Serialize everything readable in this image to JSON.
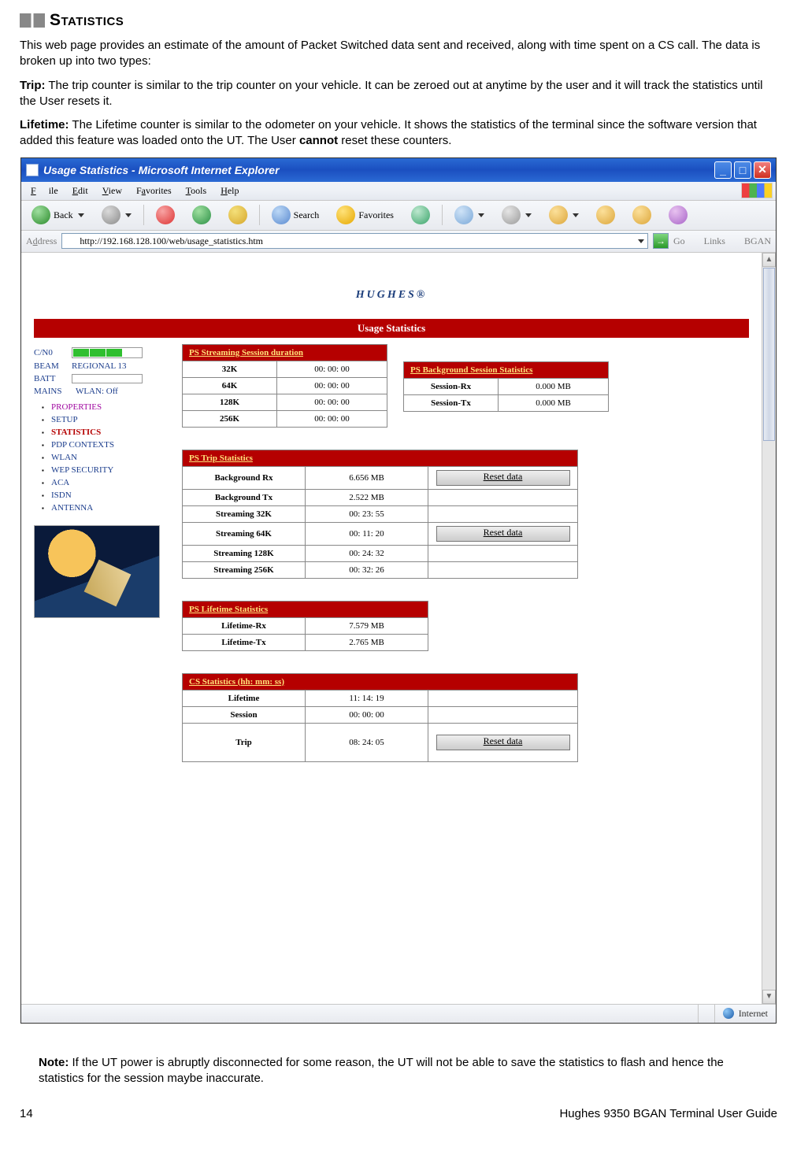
{
  "doc": {
    "section_title": "Statistics",
    "para1": "This web page provides an estimate of the amount of Packet Switched data sent and received, along with time spent on a CS call.  The data is broken up into two types:",
    "trip_label": "Trip:",
    "trip_text": "  The trip counter is similar to the trip counter on your vehicle.  It can be zeroed out at anytime by the user and it will track the statistics until the User resets it.",
    "lifetime_label": "Lifetime:",
    "lifetime_text_a": "  The Lifetime counter is similar to the odometer on your vehicle.  It shows the statistics of the terminal since the software version that added this feature was loaded onto the UT.  The User ",
    "lifetime_cannot": "cannot",
    "lifetime_text_b": " reset these counters.",
    "note_label": "Note:",
    "note_text": " If the UT power is abruptly disconnected for some reason, the UT will not be able to save the statistics to flash and hence the statistics for the session maybe inaccurate.",
    "page_number": "14",
    "footer_title": "Hughes 9350 BGAN Terminal User Guide"
  },
  "window": {
    "title": "Usage Statistics - Microsoft Internet Explorer",
    "menu": {
      "file": "File",
      "edit": "Edit",
      "view": "View",
      "favorites": "Favorites",
      "tools": "Tools",
      "help": "Help"
    },
    "toolbar": {
      "back": "Back",
      "search": "Search",
      "favorites": "Favorites"
    },
    "address_label": "Address",
    "address_url": "http://192.168.128.100/web/usage_statistics.htm",
    "go": "Go",
    "links_label": "Links",
    "links_item": "BGAN",
    "statusbar_zone": "Internet"
  },
  "logo": {
    "text": "HUGHES",
    "dot": "®"
  },
  "banner": "Usage Statistics",
  "sidebar": {
    "cn0_label": "C/N0",
    "beam_label": "BEAM",
    "beam_value": "REGIONAL 13",
    "batt_label": "BATT",
    "mains_label": "MAINS",
    "wlan_label": "WLAN: Off",
    "nav": [
      {
        "label": "PROPERTIES",
        "cls": "mag"
      },
      {
        "label": "SETUP",
        "cls": ""
      },
      {
        "label": "STATISTICS",
        "cls": "active"
      },
      {
        "label": "PDP CONTEXTS",
        "cls": ""
      },
      {
        "label": "WLAN",
        "cls": ""
      },
      {
        "label": "WEP SECURITY",
        "cls": ""
      },
      {
        "label": "ACA",
        "cls": ""
      },
      {
        "label": "ISDN",
        "cls": ""
      },
      {
        "label": "ANTENNA",
        "cls": ""
      }
    ]
  },
  "streaming": {
    "header": "PS Streaming Session duration",
    "rows": [
      {
        "k": "32K",
        "v": "00: 00: 00"
      },
      {
        "k": "64K",
        "v": "00: 00: 00"
      },
      {
        "k": "128K",
        "v": "00: 00: 00"
      },
      {
        "k": "256K",
        "v": "00: 00: 00"
      }
    ]
  },
  "bg": {
    "header": "PS Background Session Statistics",
    "rows": [
      {
        "k": "Session-Rx",
        "v": "0.000 MB"
      },
      {
        "k": "Session-Tx",
        "v": "0.000 MB"
      }
    ]
  },
  "trip": {
    "header": "PS Trip Statistics",
    "rows": [
      {
        "k": "Background Rx",
        "v": "6.656 MB"
      },
      {
        "k": "Background Tx",
        "v": "2.522 MB"
      },
      {
        "k": "Streaming 32K",
        "v": "00: 23: 55"
      },
      {
        "k": "Streaming 64K",
        "v": "00: 11: 20"
      },
      {
        "k": "Streaming 128K",
        "v": "00: 24: 32"
      },
      {
        "k": "Streaming 256K",
        "v": "00: 32: 26"
      }
    ],
    "reset_label": "Reset data"
  },
  "lifetime": {
    "header": "PS Lifetime Statistics",
    "rows": [
      {
        "k": "Lifetime-Rx",
        "v": "7.579 MB"
      },
      {
        "k": "Lifetime-Tx",
        "v": "2.765 MB"
      }
    ]
  },
  "cs": {
    "header": "CS Statistics    (hh: mm: ss)",
    "rows": [
      {
        "k": "Lifetime",
        "v": "11: 14: 19"
      },
      {
        "k": "Session",
        "v": "00: 00: 00"
      },
      {
        "k": "Trip",
        "v": "08: 24: 05"
      }
    ],
    "reset_label": "Reset data"
  }
}
